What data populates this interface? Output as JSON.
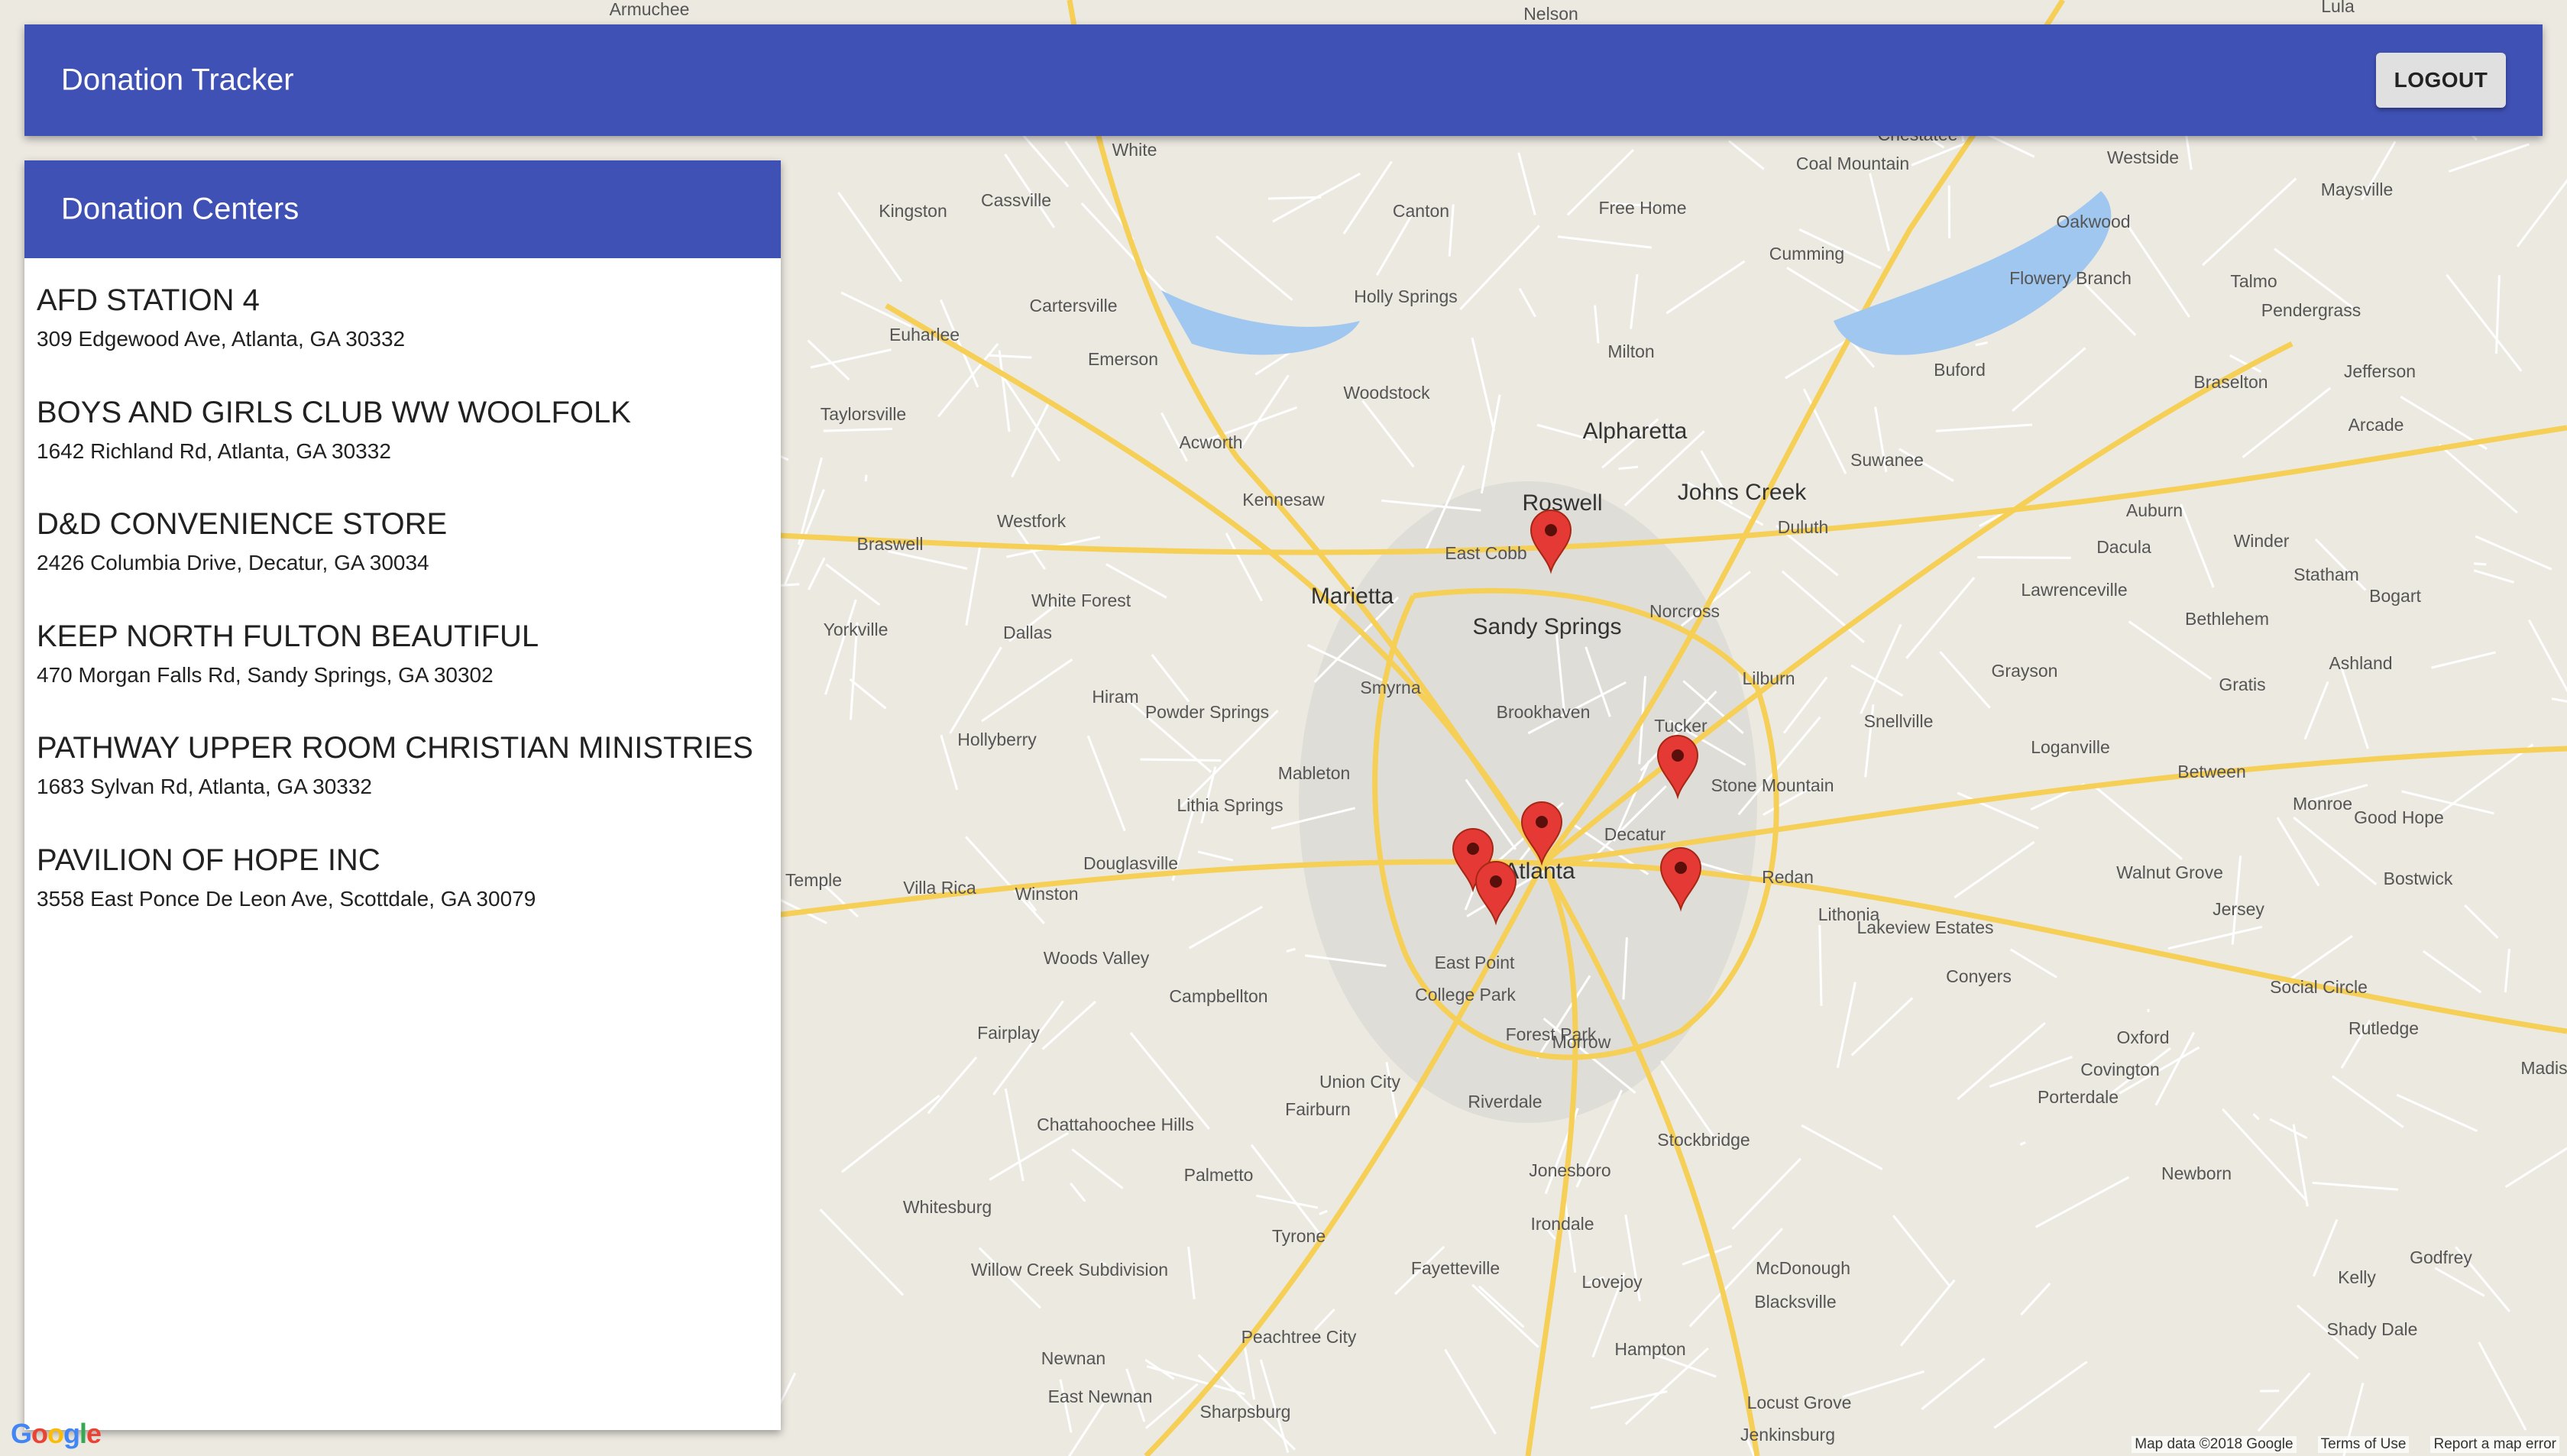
{
  "app": {
    "title": "Donation Tracker",
    "logout_label": "LOGOUT",
    "accent_color": "#3f51b5"
  },
  "panel": {
    "title": "Donation Centers",
    "centers": [
      {
        "name": "AFD STATION 4",
        "address": "309 Edgewood Ave, Atlanta, GA 30332"
      },
      {
        "name": "BOYS AND GIRLS CLUB WW WOOLFOLK",
        "address": "1642 Richland Rd, Atlanta, GA 30332"
      },
      {
        "name": "D&D CONVENIENCE STORE",
        "address": "2426 Columbia Drive, Decatur, GA 30034"
      },
      {
        "name": "KEEP NORTH FULTON BEAUTIFUL",
        "address": "470 Morgan Falls Rd, Sandy Springs, GA 30302"
      },
      {
        "name": "PATHWAY UPPER ROOM CHRISTIAN MINISTRIES",
        "address": "1683 Sylvan Rd, Atlanta, GA 30332"
      },
      {
        "name": "PAVILION OF HOPE INC",
        "address": "3558 East Ponce De Leon Ave, Scottdale, GA 30079"
      }
    ]
  },
  "map": {
    "marker_color": "#e53935",
    "labels": [
      {
        "text": "Marietta",
        "major": true
      },
      {
        "text": "Roswell",
        "major": true
      },
      {
        "text": "Alpharetta",
        "major": true
      },
      {
        "text": "Sandy Springs",
        "major": true
      },
      {
        "text": "Atlanta",
        "major": true
      },
      {
        "text": "Johns Creek",
        "major": true
      },
      {
        "text": "Decatur",
        "major": false
      },
      {
        "text": "Kennesaw",
        "major": false
      },
      {
        "text": "East Cobb",
        "major": false
      },
      {
        "text": "Smyrna",
        "major": false
      },
      {
        "text": "Brookhaven",
        "major": false
      },
      {
        "text": "Tucker",
        "major": false
      },
      {
        "text": "Norcross",
        "major": false
      },
      {
        "text": "Duluth",
        "major": false
      },
      {
        "text": "Lilburn",
        "major": false
      },
      {
        "text": "Snellville",
        "major": false
      },
      {
        "text": "Stone Mountain",
        "major": false
      },
      {
        "text": "Redan",
        "major": false
      },
      {
        "text": "Lithonia",
        "major": false
      },
      {
        "text": "East Point",
        "major": false
      },
      {
        "text": "College Park",
        "major": false
      },
      {
        "text": "Forest Park",
        "major": false
      },
      {
        "text": "Union City",
        "major": false
      },
      {
        "text": "Riverdale",
        "major": false
      },
      {
        "text": "Morrow",
        "major": false
      },
      {
        "text": "Jonesboro",
        "major": false
      },
      {
        "text": "Stockbridge",
        "major": false
      },
      {
        "text": "Mableton",
        "major": false
      },
      {
        "text": "Lithia Springs",
        "major": false
      },
      {
        "text": "Douglasville",
        "major": false
      },
      {
        "text": "Powder Springs",
        "major": false
      },
      {
        "text": "Hiram",
        "major": false
      },
      {
        "text": "Dallas",
        "major": false
      },
      {
        "text": "Acworth",
        "major": false
      },
      {
        "text": "Woodstock",
        "major": false
      },
      {
        "text": "Holly Springs",
        "major": false
      },
      {
        "text": "Canton",
        "major": false
      },
      {
        "text": "Milton",
        "major": false
      },
      {
        "text": "Cumming",
        "major": false
      },
      {
        "text": "Suwanee",
        "major": false
      },
      {
        "text": "Buford",
        "major": false
      },
      {
        "text": "Lawrenceville",
        "major": false
      },
      {
        "text": "Dacula",
        "major": false
      },
      {
        "text": "Auburn",
        "major": false
      },
      {
        "text": "Winder",
        "major": false
      },
      {
        "text": "Loganville",
        "major": false
      },
      {
        "text": "Grayson",
        "major": false
      },
      {
        "text": "Conyers",
        "major": false
      },
      {
        "text": "Covington",
        "major": false
      },
      {
        "text": "McDonough",
        "major": false
      },
      {
        "text": "Fayetteville",
        "major": false
      },
      {
        "text": "Peachtree City",
        "major": false
      },
      {
        "text": "Newnan",
        "major": false
      },
      {
        "text": "Fairburn",
        "major": false
      },
      {
        "text": "Palmetto",
        "major": false
      },
      {
        "text": "Tyrone",
        "major": false
      },
      {
        "text": "Hampton",
        "major": false
      },
      {
        "text": "Lovejoy",
        "major": false
      },
      {
        "text": "Irondale",
        "major": false
      },
      {
        "text": "Blacksville",
        "major": false
      },
      {
        "text": "Locust Grove",
        "major": false
      },
      {
        "text": "Cartersville",
        "major": false
      },
      {
        "text": "Euharlee",
        "major": false
      },
      {
        "text": "Emerson",
        "major": false
      },
      {
        "text": "Taylorsville",
        "major": false
      },
      {
        "text": "Kingston",
        "major": false
      },
      {
        "text": "Cassville",
        "major": false
      },
      {
        "text": "White",
        "major": false
      },
      {
        "text": "Braswell",
        "major": false
      },
      {
        "text": "Westfork",
        "major": false
      },
      {
        "text": "White Forest",
        "major": false
      },
      {
        "text": "Yorkville",
        "major": false
      },
      {
        "text": "Hollyberry",
        "major": false
      },
      {
        "text": "Villa Rica",
        "major": false
      },
      {
        "text": "Temple",
        "major": false
      },
      {
        "text": "Winston",
        "major": false
      },
      {
        "text": "Woods Valley",
        "major": false
      },
      {
        "text": "Campbellton",
        "major": false
      },
      {
        "text": "Fairplay",
        "major": false
      },
      {
        "text": "Chattahoochee Hills",
        "major": false
      },
      {
        "text": "Whitesburg",
        "major": false
      },
      {
        "text": "Willow Creek Subdivision",
        "major": false
      },
      {
        "text": "East Newnan",
        "major": false
      },
      {
        "text": "Sharpsburg",
        "major": false
      },
      {
        "text": "Free Home",
        "major": false
      },
      {
        "text": "Coal Mountain",
        "major": false
      },
      {
        "text": "Chestatee",
        "major": false
      },
      {
        "text": "Oakwood",
        "major": false
      },
      {
        "text": "Flowery Branch",
        "major": false
      },
      {
        "text": "Braselton",
        "major": false
      },
      {
        "text": "Jefferson",
        "major": false
      },
      {
        "text": "Statham",
        "major": false
      },
      {
        "text": "Bethlehem",
        "major": false
      },
      {
        "text": "Bogart",
        "major": false
      },
      {
        "text": "Gratis",
        "major": false
      },
      {
        "text": "Between",
        "major": false
      },
      {
        "text": "Monroe",
        "major": false
      },
      {
        "text": "Good Hope",
        "major": false
      },
      {
        "text": "Walnut Grove",
        "major": false
      },
      {
        "text": "Jersey",
        "major": false
      },
      {
        "text": "Social Circle",
        "major": false
      },
      {
        "text": "Rutledge",
        "major": false
      },
      {
        "text": "Oxford",
        "major": false
      },
      {
        "text": "Porterdale",
        "major": false
      },
      {
        "text": "Newborn",
        "major": false
      },
      {
        "text": "Kelly",
        "major": false
      },
      {
        "text": "Shady Dale",
        "major": false
      },
      {
        "text": "Godfrey",
        "major": false
      },
      {
        "text": "Jenkinsburg",
        "major": false
      },
      {
        "text": "Lakeview Estates",
        "major": false
      },
      {
        "text": "Bostwick",
        "major": false
      },
      {
        "text": "Arcade",
        "major": false
      },
      {
        "text": "Talmo",
        "major": false
      },
      {
        "text": "Pendergrass",
        "major": false
      },
      {
        "text": "Maysville",
        "major": false
      },
      {
        "text": "Westside",
        "major": false
      },
      {
        "text": "Lula",
        "major": false
      },
      {
        "text": "Nelson",
        "major": false
      },
      {
        "text": "Armuchee",
        "major": false
      },
      {
        "text": "Ashland",
        "major": false
      },
      {
        "text": "Madis",
        "major": false
      }
    ],
    "footer": {
      "logo": "Google",
      "attribution": "Map data ©2018 Google",
      "terms": "Terms of Use",
      "report": "Report a map error"
    }
  }
}
